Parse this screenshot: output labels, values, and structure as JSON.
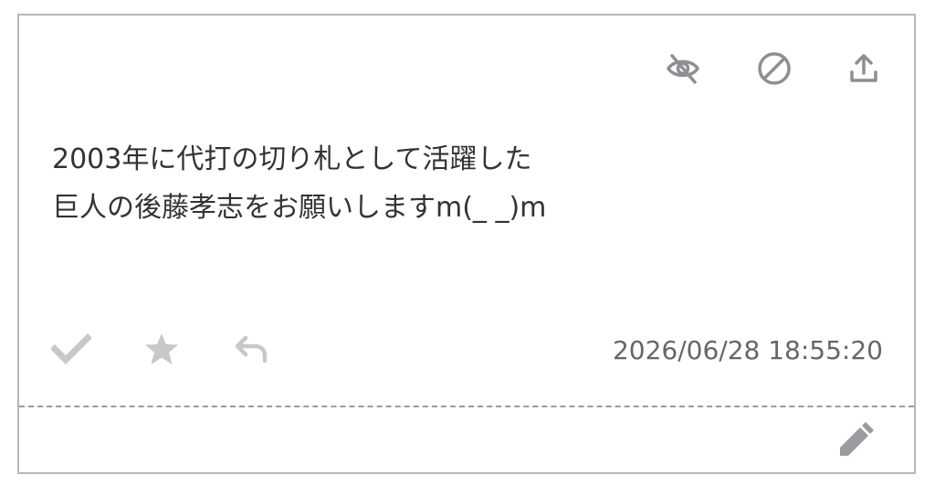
{
  "message": {
    "line1": "2003年に代打の切り札として活躍した",
    "line2": "巨人の後藤孝志をお願いしますm(_ _)m"
  },
  "timestamp": "2026/06/28 18:55:20",
  "icons": {
    "hide": "eye-slash-icon",
    "block": "ban-icon",
    "share": "upload-icon",
    "check": "check-icon",
    "star": "star-icon",
    "reply": "reply-icon",
    "edit": "pencil-icon"
  },
  "colors": {
    "icon_active": "#8e8e93",
    "icon_muted": "#c8c8cc",
    "border": "#b5b5ba",
    "text": "#333333"
  }
}
